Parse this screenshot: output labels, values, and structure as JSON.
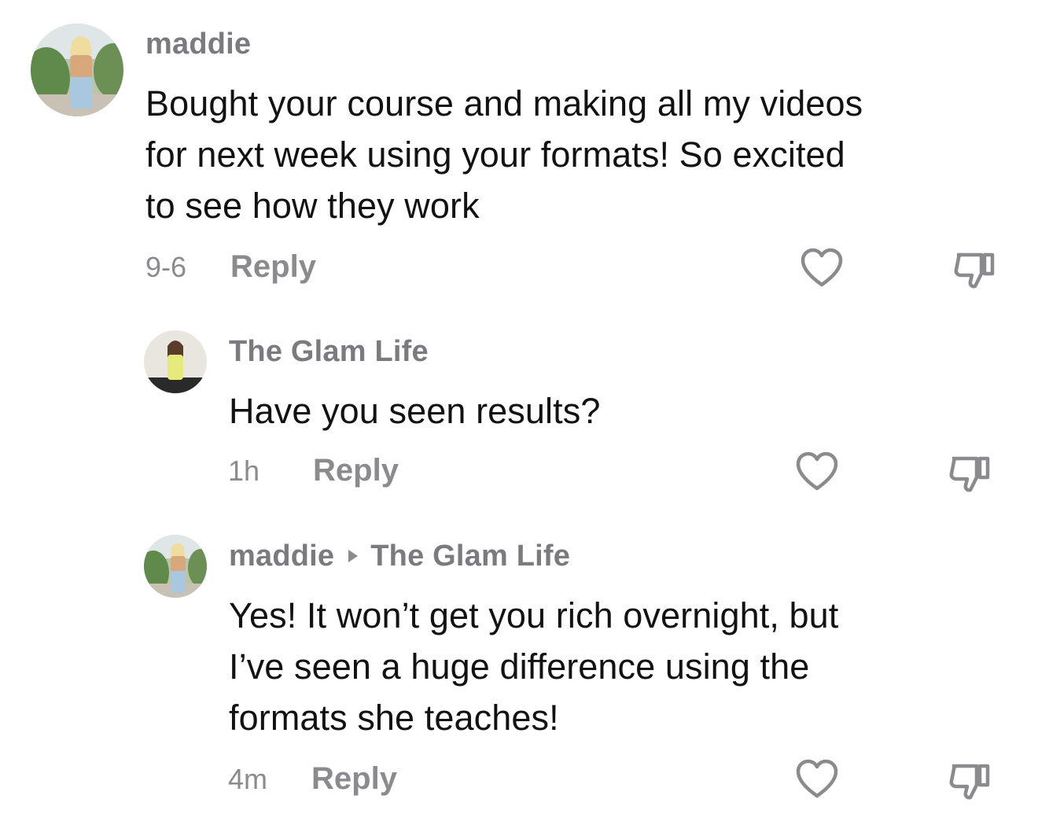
{
  "comments": [
    {
      "username": "maddie",
      "text_lines": [
        "Bought your course and making all my videos",
        "for next week using your formats! So excited",
        "to see how they work"
      ],
      "time": "9-6",
      "reply_label": "Reply",
      "like_icon": "heart-icon",
      "dislike_icon": "thumbs-down-icon"
    },
    {
      "username": "The Glam Life",
      "text_lines": [
        "Have you seen results?"
      ],
      "time": "1h",
      "reply_label": "Reply",
      "like_icon": "heart-icon",
      "dislike_icon": "thumbs-down-icon"
    },
    {
      "username": "maddie",
      "reply_to": "The Glam Life",
      "text_lines": [
        "Yes! It won’t get you rich overnight, but",
        "I’ve seen a huge difference using the",
        "formats she teaches!"
      ],
      "time": "4m",
      "reply_label": "Reply",
      "like_icon": "heart-icon",
      "dislike_icon": "thumbs-down-icon"
    }
  ],
  "colors": {
    "secondary_text": "#8a8a8f",
    "primary_text": "#121212",
    "background": "#ffffff"
  }
}
